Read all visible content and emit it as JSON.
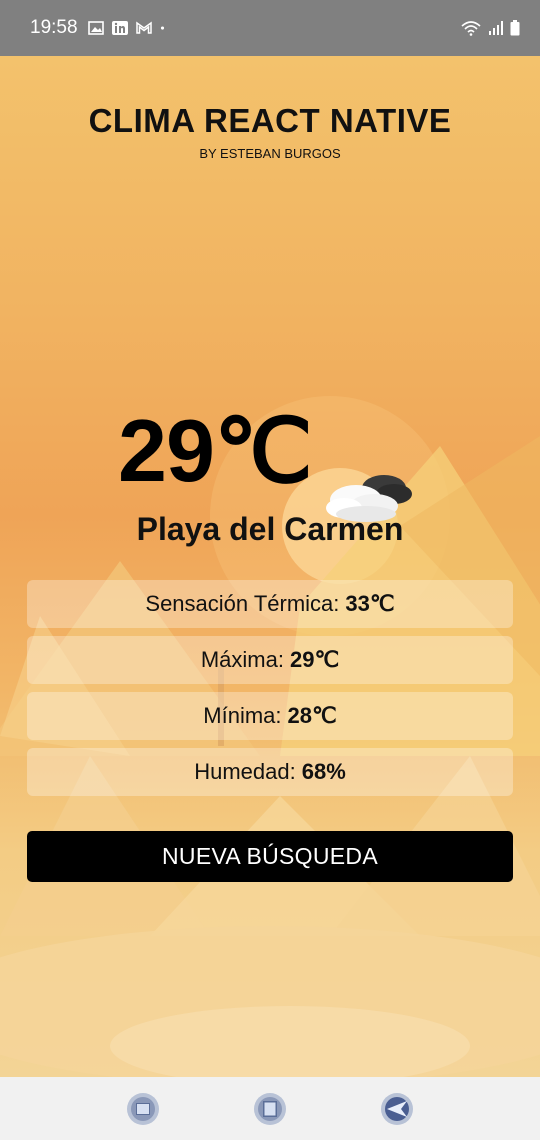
{
  "status_bar": {
    "time": "19:58",
    "left_icons": [
      "image-icon",
      "linkedin-icon",
      "gmail-icon",
      "dot-icon"
    ],
    "right_icons": [
      "wifi-icon",
      "signal-icon",
      "battery-icon"
    ]
  },
  "header": {
    "title": "CLIMA REACT NATIVE",
    "subtitle": "BY ESTEBAN BURGOS"
  },
  "weather": {
    "temperature": "29℃",
    "icon": "partly-cloudy-icon",
    "city": "Playa del Carmen",
    "rows": [
      {
        "label": "Sensación Térmica:",
        "value": "33℃"
      },
      {
        "label": "Máxima:",
        "value": "29℃"
      },
      {
        "label": "Mínima:",
        "value": "28℃"
      },
      {
        "label": "Humedad:",
        "value": "68%"
      }
    ]
  },
  "actions": {
    "new_search_label": "NUEVA BÚSQUEDA"
  },
  "nav_bar": {
    "buttons": [
      "recent-apps-icon",
      "home-icon",
      "back-icon"
    ]
  },
  "colors": {
    "status_bar": "#808080",
    "button_bg": "#000000",
    "button_text": "#ffffff",
    "nav_bar": "#f1f1f1"
  }
}
